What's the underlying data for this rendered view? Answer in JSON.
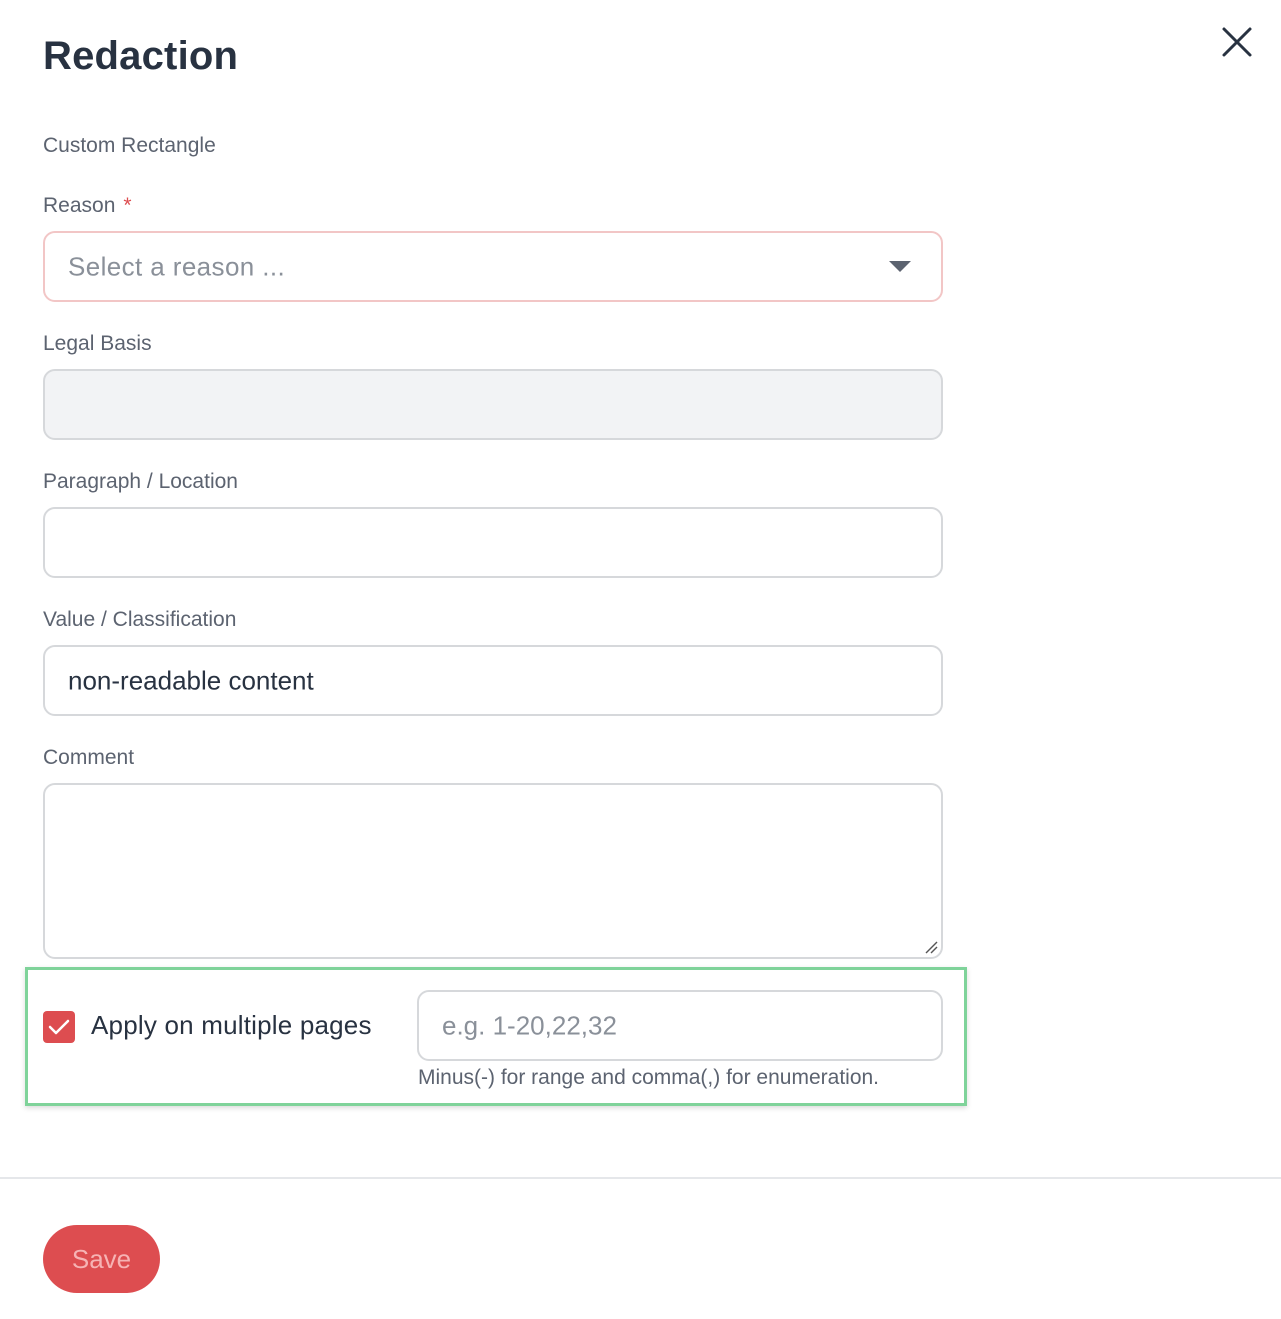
{
  "dialog": {
    "title": "Redaction",
    "subtitle": "Custom Rectangle"
  },
  "form": {
    "reason": {
      "label": "Reason",
      "required_mark": "*",
      "placeholder": "Select a reason ..."
    },
    "legal_basis": {
      "label": "Legal Basis",
      "value": ""
    },
    "paragraph": {
      "label": "Paragraph / Location",
      "value": ""
    },
    "value_classification": {
      "label": "Value / Classification",
      "value": "non-readable content"
    },
    "comment": {
      "label": "Comment",
      "value": ""
    },
    "multiple_pages": {
      "checked": true,
      "label": "Apply on multiple pages",
      "placeholder": "e.g. 1-20,22,32",
      "hint": "Minus(-) for range and comma(,) for enumeration."
    }
  },
  "footer": {
    "save_label": "Save"
  },
  "colors": {
    "accent": "#dd4d50",
    "highlight": "#7fd39a",
    "text": "#283241",
    "muted": "#5c6370"
  },
  "icons": {
    "close": "close-icon",
    "caret": "chevron-down-icon",
    "check": "checkmark-icon",
    "resize": "resize-handle-icon"
  }
}
